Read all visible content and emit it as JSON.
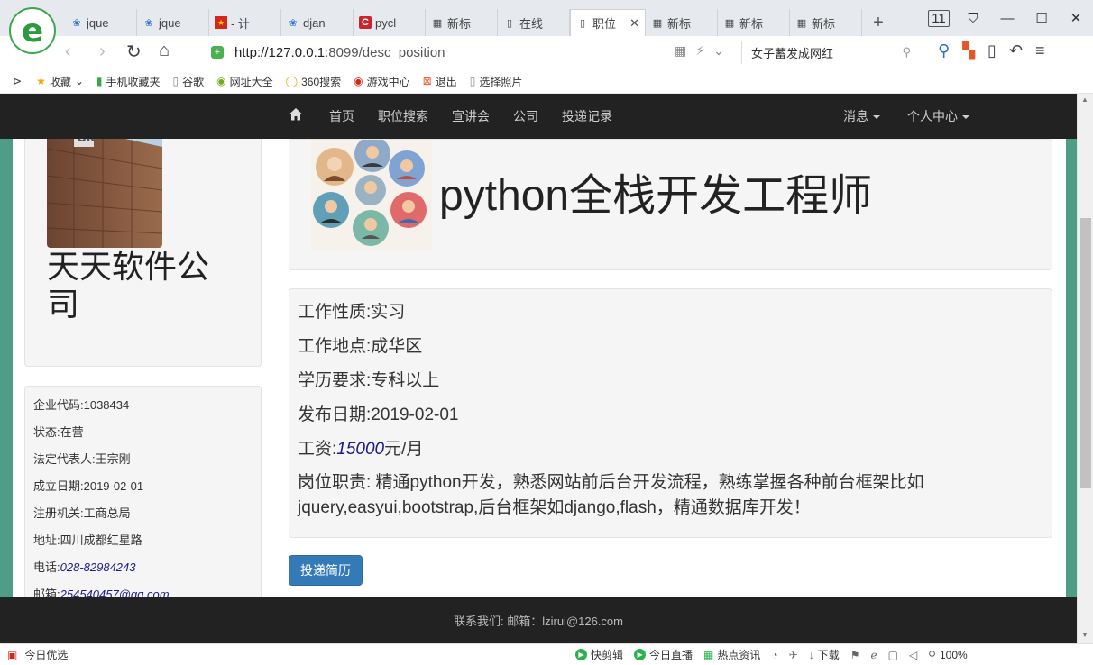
{
  "browser": {
    "tabs": [
      {
        "label": "jque",
        "icon": "paw-icon",
        "active": false
      },
      {
        "label": "jque",
        "icon": "paw-icon",
        "active": false
      },
      {
        "label": "- 计",
        "icon": "flag-icon",
        "active": false
      },
      {
        "label": "djan",
        "icon": "paw-icon",
        "active": false
      },
      {
        "label": "pycl",
        "icon": "c-icon",
        "active": false
      },
      {
        "label": "新标",
        "icon": "grid-icon",
        "active": false
      },
      {
        "label": "在线",
        "icon": "page-icon",
        "active": false
      },
      {
        "label": "职位",
        "icon": "page-icon",
        "active": true
      },
      {
        "label": "新标",
        "icon": "grid-icon",
        "active": false
      },
      {
        "label": "新标",
        "icon": "grid-icon",
        "active": false
      },
      {
        "label": "新标",
        "icon": "grid-icon",
        "active": false
      }
    ],
    "tab_count": "11",
    "url_host": "http://127.0.0.1",
    "url_rest": ":8099/desc_position",
    "search_text": "女子蓄发成网红",
    "bookmarks": [
      {
        "label": "收藏",
        "icon": "star-icon"
      },
      {
        "label": "手机收藏夹",
        "icon": "phone-icon"
      },
      {
        "label": "谷歌",
        "icon": "page-icon"
      },
      {
        "label": "网址大全",
        "icon": "globe-icon"
      },
      {
        "label": "360搜索",
        "icon": "search-icon"
      },
      {
        "label": "游戏中心",
        "icon": "game-icon"
      },
      {
        "label": "退出",
        "icon": "exit-icon"
      },
      {
        "label": "选择照片",
        "icon": "page-icon"
      }
    ],
    "status": {
      "left": "今日优选",
      "items": [
        "快剪辑",
        "今日直播",
        "热点资讯",
        "下载"
      ],
      "zoom": "100%"
    }
  },
  "nav": {
    "links": [
      "首页",
      "职位搜索",
      "宣讲会",
      "公司",
      "投递记录"
    ],
    "right": [
      "消息",
      "个人中心"
    ]
  },
  "company": {
    "name": "天天软件公司",
    "logo_text": "GK",
    "code": "企业代码:1038434",
    "status": "状态:在营",
    "rep": "法定代表人:王宗刚",
    "founded": "成立日期:2019-02-01",
    "authority": "注册机关:工商总局",
    "address": "地址:四川成都红星路",
    "phone_label": "电话:",
    "phone": "028-82984243",
    "email_label": "邮箱:",
    "email": "254540457@qq.com"
  },
  "job": {
    "title": "python全栈开发工程师",
    "nature": "工作性质:实习",
    "location": "工作地点:成华区",
    "education": "学历要求:专科以上",
    "date": "发布日期:2019-02-01",
    "salary_label": "工资:",
    "salary": "15000",
    "salary_unit": "元/月",
    "duty": "岗位职责: 精通python开发，熟悉网站前后台开发流程，熟练掌握各种前台框架比如jquery,easyui,bootstrap,后台框架如django,flash，精通数据库开发！"
  },
  "apply_label": "投递简历",
  "footer": "联系我们:  邮箱：lzirui@126.com"
}
